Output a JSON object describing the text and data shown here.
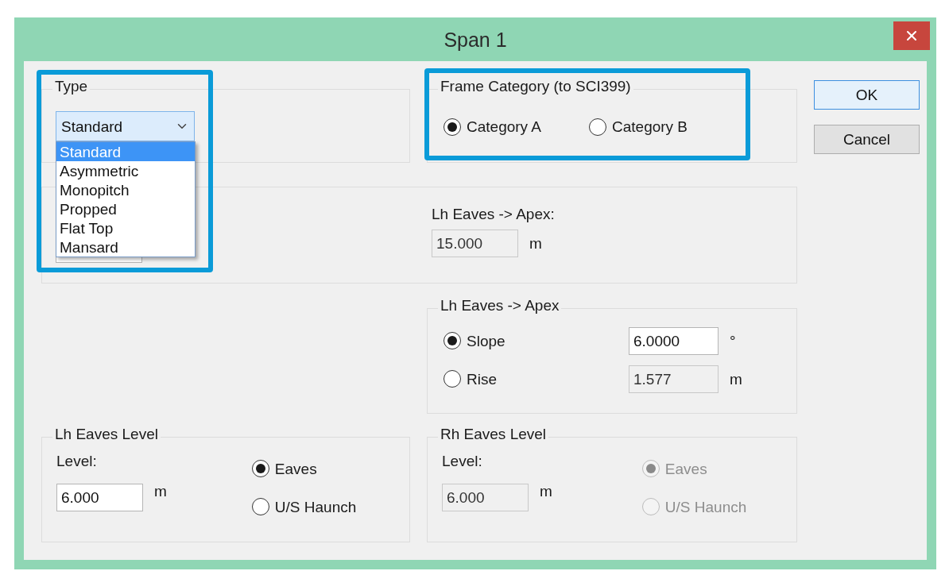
{
  "window": {
    "title": "Span 1"
  },
  "type_group": {
    "label": "Type",
    "combo": {
      "value": "Standard",
      "expanded": true
    },
    "options": [
      {
        "label": "Standard",
        "selected": true
      },
      {
        "label": "Asymmetric",
        "selected": false
      },
      {
        "label": "Monopitch",
        "selected": false
      },
      {
        "label": "Propped",
        "selected": false
      },
      {
        "label": "Flat Top",
        "selected": false
      },
      {
        "label": "Mansard",
        "selected": false
      }
    ]
  },
  "frame_category": {
    "label": "Frame Category (to SCI399)",
    "options": [
      {
        "label": "Category A",
        "selected": true
      },
      {
        "label": "Category B",
        "selected": false
      }
    ]
  },
  "span_group": {
    "lh_eaves_apex": {
      "label": "Lh Eaves -> Apex:",
      "value": "15.000",
      "unit": "m",
      "disabled": true
    }
  },
  "slope_group": {
    "label": "Lh Eaves -> Apex",
    "rows": [
      {
        "label": "Slope",
        "selected": true,
        "value": "6.0000",
        "unit": "°",
        "disabled": false
      },
      {
        "label": "Rise",
        "selected": false,
        "value": "1.577",
        "unit": "m",
        "disabled": true
      }
    ]
  },
  "lh_eaves_level": {
    "label": "Lh Eaves Level",
    "level_label": "Level:",
    "value": "6.000",
    "unit": "m",
    "disabled": false,
    "options": [
      {
        "label": "Eaves",
        "selected": true
      },
      {
        "label": "U/S Haunch",
        "selected": false
      }
    ]
  },
  "rh_eaves_level": {
    "label": "Rh Eaves Level",
    "level_label": "Level:",
    "value": "6.000",
    "unit": "m",
    "disabled": true,
    "options": [
      {
        "label": "Eaves",
        "selected": true
      },
      {
        "label": "U/S Haunch",
        "selected": false
      }
    ]
  },
  "buttons": [
    {
      "label": "OK",
      "default": true
    },
    {
      "label": "Cancel",
      "default": false
    }
  ]
}
